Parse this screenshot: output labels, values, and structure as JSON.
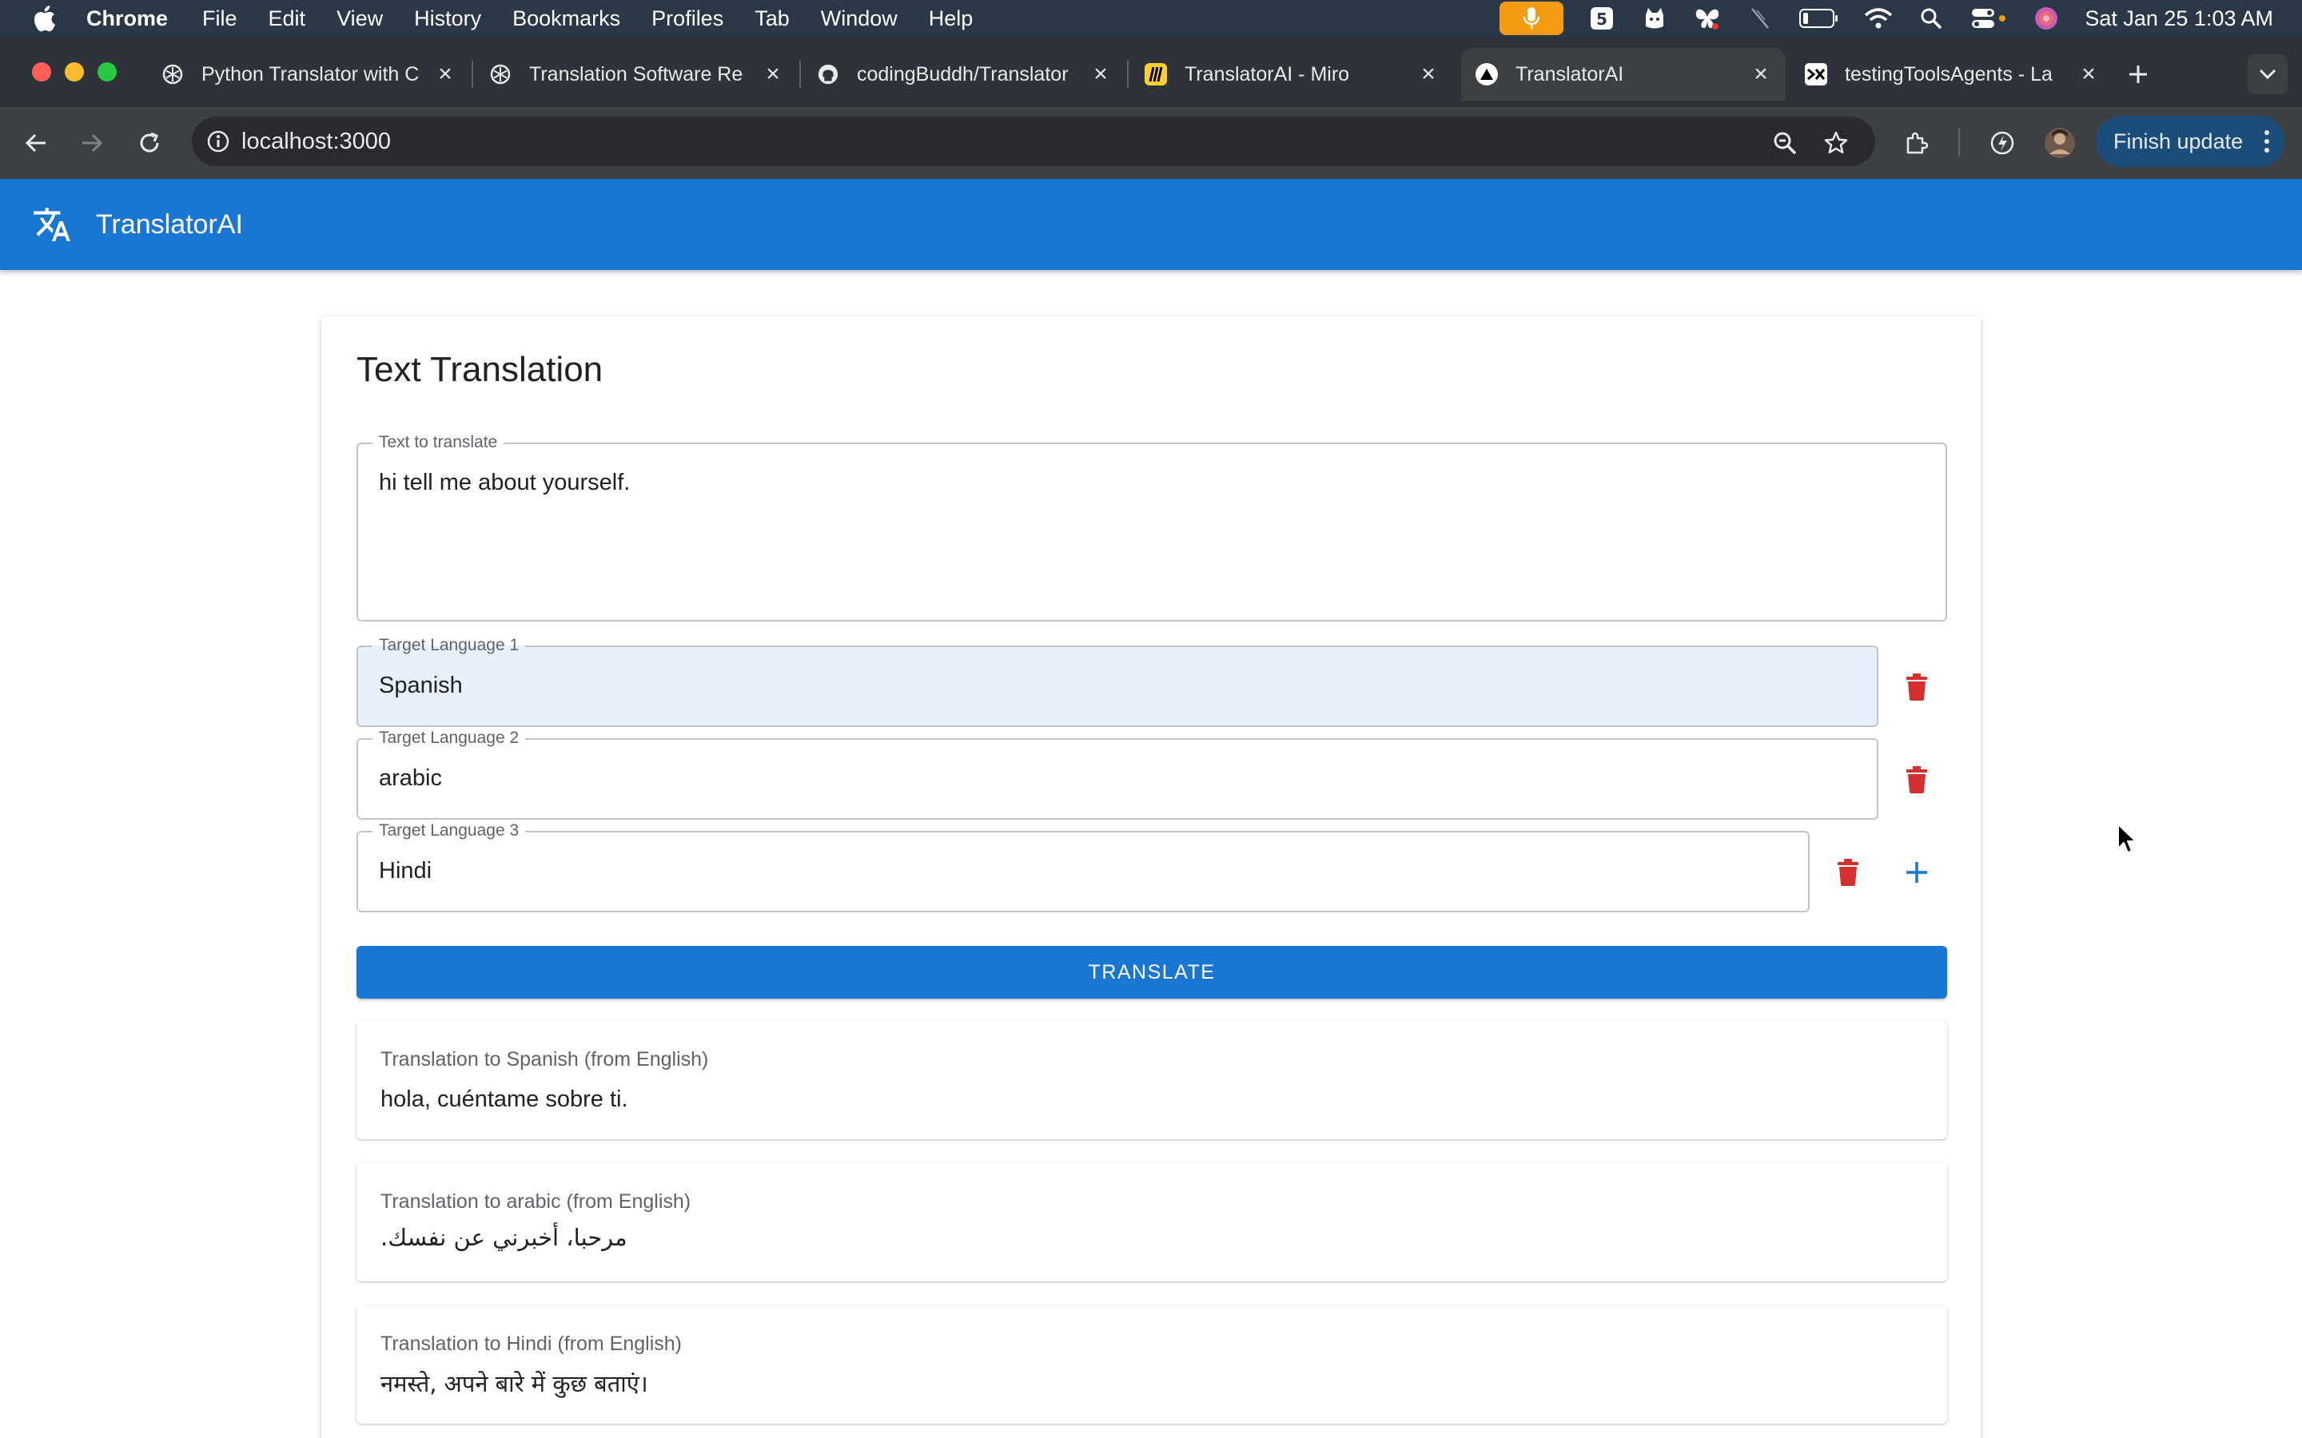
{
  "menubar": {
    "app_name": "Chrome",
    "items": [
      "File",
      "Edit",
      "View",
      "History",
      "Bookmarks",
      "Profiles",
      "Tab",
      "Window",
      "Help"
    ],
    "clock": "Sat Jan 25  1:03 AM"
  },
  "browser": {
    "tabs": [
      {
        "title": "Python Translator with C",
        "icon": "openai-icon"
      },
      {
        "title": "Translation Software Re",
        "icon": "openai-icon"
      },
      {
        "title": "codingBuddh/Translator",
        "icon": "github-icon"
      },
      {
        "title": "TranslatorAI - Miro",
        "icon": "miro-icon"
      },
      {
        "title": "TranslatorAI",
        "icon": "nextjs-icon",
        "active": true
      },
      {
        "title": "testingToolsAgents - La",
        "icon": "langchain-icon"
      }
    ],
    "url": "localhost:3000",
    "finish_update": "Finish update"
  },
  "app": {
    "title": "TranslatorAI"
  },
  "form": {
    "heading": "Text Translation",
    "source_label": "Text to translate",
    "source_text": "hi tell me about yourself.",
    "targets": [
      {
        "label": "Target Language 1",
        "value": "Spanish"
      },
      {
        "label": "Target Language 2",
        "value": "arabic"
      },
      {
        "label": "Target Language 3",
        "value": "Hindi"
      }
    ],
    "translate_label": "TRANSLATE"
  },
  "results": [
    {
      "label": "Translation to Spanish (from English)",
      "text": "hola, cuéntame sobre ti."
    },
    {
      "label": "Translation to arabic (from English)",
      "text": "مرحبا، أخبرني عن نفسك."
    },
    {
      "label": "Translation to Hindi (from English)",
      "text": "नमस्ते, अपने बारे में कुछ बताएं।"
    }
  ],
  "colors": {
    "primary": "#1976d2",
    "delete": "#d32f2f",
    "menubar": "#2a3746",
    "browser_chrome": "#3c4043"
  }
}
